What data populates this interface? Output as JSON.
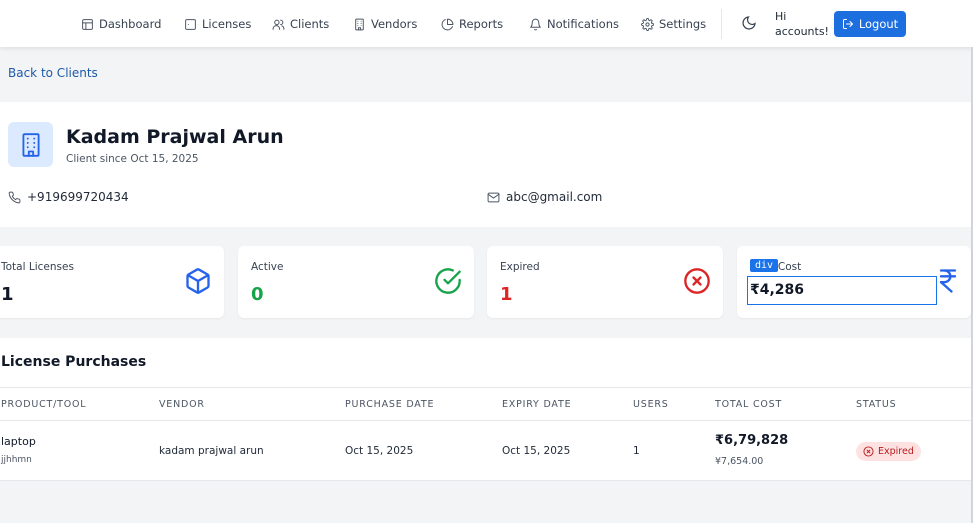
{
  "nav": {
    "dashboard": "Dashboard",
    "licenses": "Licenses",
    "clients": "Clients",
    "vendors": "Vendors",
    "reports": "Reports",
    "notifications": "Notifications",
    "settings": "Settings",
    "greeting": "Hi accounts!",
    "logout": "Logout"
  },
  "back_link": "Back to Clients",
  "client": {
    "name": "Kadam Prajwal Arun",
    "since": "Client since Oct 15, 2025",
    "phone": "+919699720434",
    "email": "abc@gmail.com"
  },
  "stats": {
    "total_label": "Total Licenses",
    "total_value": "1",
    "active_label": "Active",
    "active_value": "0",
    "expired_label": "Expired",
    "expired_value": "1",
    "cost_label": "Total Cost",
    "cost_value": "₹4,286"
  },
  "devtools": {
    "tag": "div"
  },
  "purchases": {
    "title": "License Purchases",
    "columns": [
      "PRODUCT/TOOL",
      "VENDOR",
      "PURCHASE DATE",
      "EXPIRY DATE",
      "USERS",
      "TOTAL COST",
      "STATUS"
    ],
    "rows": [
      {
        "product": "laptop",
        "product_sub": "jjhhmn",
        "vendor": "kadam prajwal arun",
        "purchase_date": "Oct 15, 2025",
        "expiry_date": "Oct 15, 2025",
        "users": "1",
        "total_cost": "₹6,79,828",
        "total_cost_sub": "¥7,654.00",
        "status": "Expired"
      }
    ]
  },
  "colors": {
    "accent": "#1d6fe0",
    "active": "#16a34a",
    "expired": "#dc2626",
    "info": "#2563eb"
  },
  "icons": {
    "dashboard": "layout-icon",
    "licenses": "square-icon",
    "clients": "users-icon",
    "vendors": "building-icon",
    "reports": "pie-chart-icon",
    "notifications": "bell-icon",
    "settings": "gear-icon",
    "theme": "moon-icon",
    "logout": "logout-icon",
    "avatar": "building-icon",
    "phone": "phone-icon",
    "email": "mail-icon",
    "total": "package-icon",
    "active": "check-circle-icon",
    "expired": "x-circle-icon",
    "cost": "rupee-icon"
  }
}
